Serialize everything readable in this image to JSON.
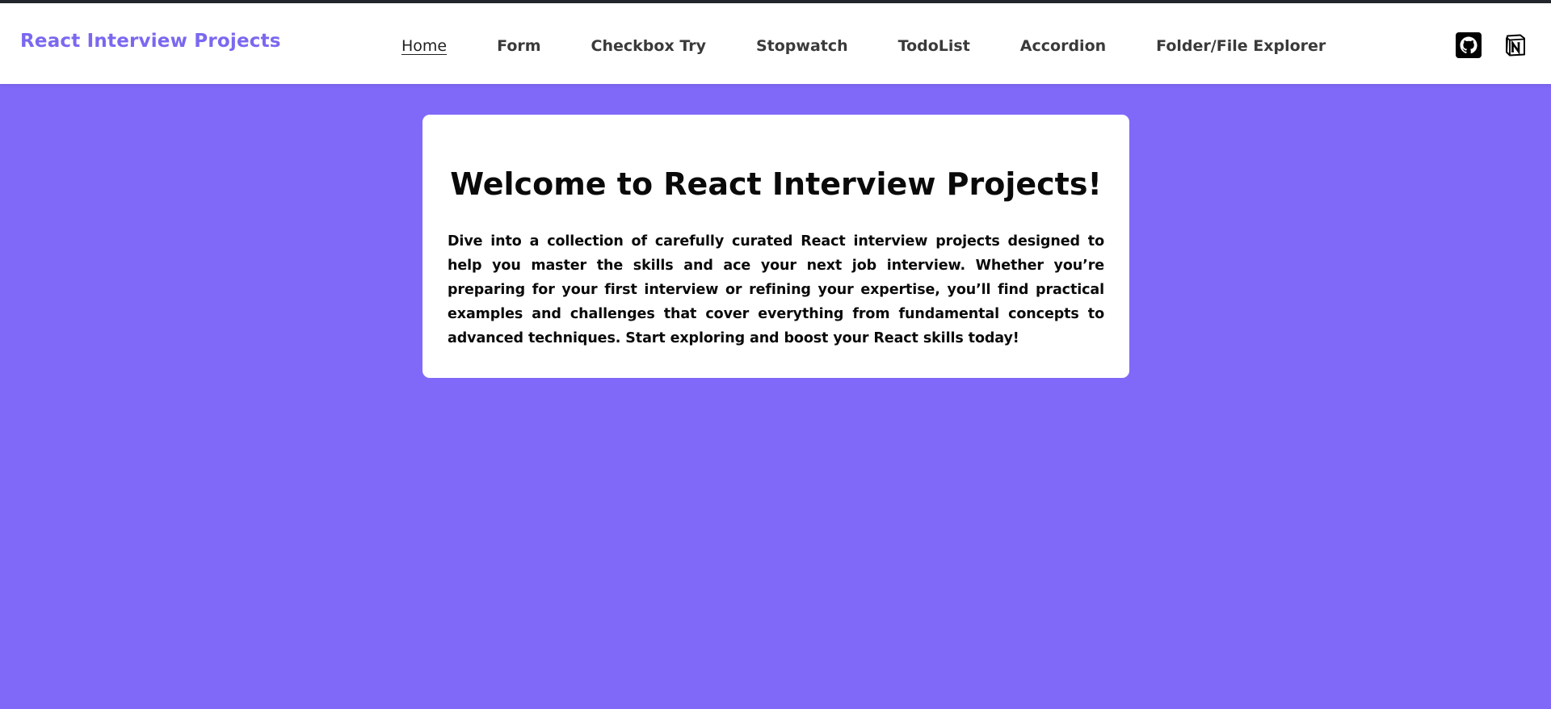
{
  "navbar": {
    "brand": "React Interview Projects",
    "links": [
      {
        "label": "Home",
        "active": true
      },
      {
        "label": "Form",
        "active": false
      },
      {
        "label": "Checkbox Try",
        "active": false
      },
      {
        "label": "Stopwatch",
        "active": false
      },
      {
        "label": "TodoList",
        "active": false
      },
      {
        "label": "Accordion",
        "active": false
      },
      {
        "label": "Folder/File Explorer",
        "active": false
      }
    ],
    "icons": [
      "github-icon",
      "notion-icon"
    ]
  },
  "main": {
    "title": "Welcome to React Interview Projects!",
    "description": "Dive into a collection of carefully curated React interview projects designed to help you master the skills and ace your next job interview. Whether you’re preparing for your first interview or refining your expertise, you’ll find practical examples and challenges that cover everything from fundamental concepts to advanced techniques. Start exploring and boost your React skills today!"
  },
  "colors": {
    "background": "#8069f9",
    "brand": "#7a68f0",
    "card": "#ffffff",
    "top_strip": "#23262b"
  }
}
